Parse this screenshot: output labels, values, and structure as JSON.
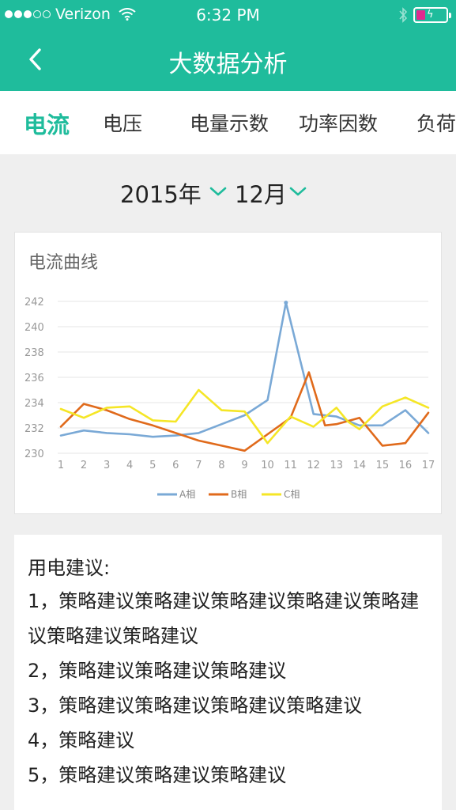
{
  "status": {
    "carrier": "Verizon",
    "time": "6:32 PM",
    "signal_dots_on": 3,
    "signal_dots_total": 5,
    "battery_color": "#e02a8f"
  },
  "nav": {
    "title": "大数据分析",
    "back_icon": "chevron-left-icon"
  },
  "tabs": [
    {
      "label": "电流",
      "active": true
    },
    {
      "label": "电压",
      "active": false
    },
    {
      "label": "电量示数",
      "active": false
    },
    {
      "label": "功率因数",
      "active": false
    },
    {
      "label": "负荷",
      "active": false
    }
  ],
  "date": {
    "year": "2015年",
    "month": "12月"
  },
  "colors": {
    "accent": "#1fbc9c",
    "series_a": "#7aa9d6",
    "series_b": "#e06a1b",
    "series_c": "#f5e626"
  },
  "chart_data": {
    "type": "line",
    "title": "电流曲线",
    "x": [
      1,
      2,
      3,
      4,
      5,
      6,
      7,
      8,
      9,
      10,
      11,
      12,
      13,
      14,
      15,
      16,
      17
    ],
    "ylim": [
      230,
      242
    ],
    "yticks": [
      230,
      232,
      234,
      236,
      238,
      240,
      242
    ],
    "grid": true,
    "legend_position": "bottom",
    "series": [
      {
        "name": "A相",
        "color": "#7aa9d6",
        "x": [
          1,
          2,
          3,
          4,
          5,
          6,
          7,
          8,
          9,
          10,
          10.8,
          12,
          13,
          14,
          15,
          16,
          17
        ],
        "values": [
          231.4,
          231.8,
          231.6,
          231.5,
          231.3,
          231.4,
          231.6,
          232.3,
          233.0,
          234.2,
          241.9,
          233.1,
          232.9,
          232.2,
          232.2,
          233.4,
          231.6
        ]
      },
      {
        "name": "B相",
        "color": "#e06a1b",
        "x": [
          1,
          2,
          3,
          4,
          5,
          6,
          7,
          8,
          9,
          10,
          11,
          11.8,
          12.5,
          13,
          14,
          15,
          16,
          17
        ],
        "values": [
          232.1,
          233.9,
          233.4,
          232.7,
          232.2,
          231.6,
          231.0,
          230.6,
          230.2,
          231.5,
          232.8,
          236.4,
          232.2,
          232.3,
          232.8,
          230.6,
          230.8,
          233.2
        ]
      },
      {
        "name": "C相",
        "color": "#f5e626",
        "x": [
          1,
          2,
          3,
          4,
          5,
          6,
          7,
          8,
          9,
          10,
          11,
          12,
          13,
          13.5,
          14,
          15,
          16,
          17
        ],
        "values": [
          233.5,
          232.8,
          233.6,
          233.7,
          232.6,
          232.5,
          235.0,
          233.4,
          233.3,
          230.8,
          232.9,
          232.1,
          233.6,
          232.5,
          231.9,
          233.7,
          234.4,
          233.6
        ]
      }
    ]
  },
  "advice": {
    "title": "用电建议:",
    "items": [
      "1，策略建议策略建议策略建议策略建议策略建议策略建议策略建议",
      "2，策略建议策略建议策略建议",
      "3，策略建议策略建议策略建议策略建议",
      "4，策略建议",
      "5，策略建议策略建议策略建议"
    ]
  }
}
